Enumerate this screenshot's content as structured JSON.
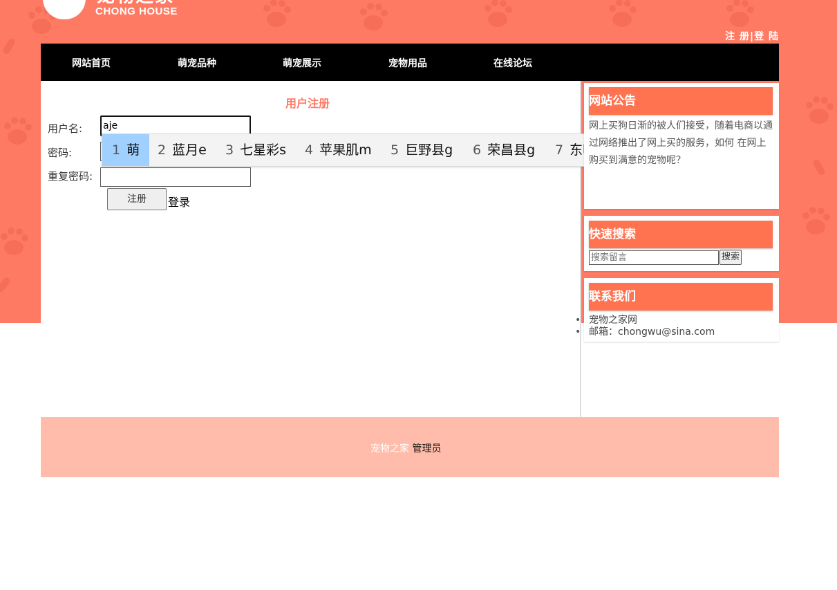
{
  "header": {
    "logo_title": "宠物之家",
    "logo_subtitle": "CHONG HOUSE",
    "register_link": "注 册",
    "separator": "|",
    "login_link": "登 陆"
  },
  "nav": {
    "items": [
      {
        "label": "网站首页"
      },
      {
        "label": "萌宠品种"
      },
      {
        "label": "萌宠展示"
      },
      {
        "label": "宠物用品"
      },
      {
        "label": "在线论坛"
      }
    ]
  },
  "register_form": {
    "title": "用户注册",
    "username_label": "用户名:",
    "username_value": "aje",
    "password_label": "密码:",
    "repeat_password_label": "重复密码:",
    "submit_label": "注册",
    "login_label": "登录"
  },
  "ime": {
    "candidates": [
      {
        "num": "1",
        "text": "萌"
      },
      {
        "num": "2",
        "text": "蓝月e"
      },
      {
        "num": "3",
        "text": "七星彩s"
      },
      {
        "num": "4",
        "text": "苹果肌m"
      },
      {
        "num": "5",
        "text": "巨野县g"
      },
      {
        "num": "6",
        "text": "荣昌县g"
      },
      {
        "num": "7",
        "text": "东明县g"
      }
    ],
    "prev_icon": "‹",
    "next_icon": "›",
    "emoji_icon": "☺"
  },
  "sidebar": {
    "notice_title": "网站公告",
    "notice_text": "网上买狗日渐的被人们接受，随着电商以通过网络推出了网上买的服务，如何 在网上购买到满意的宠物呢？",
    "search_title": "快速搜索",
    "search_placeholder": "搜索留言",
    "search_button": "搜索",
    "contact_title": "联系我们",
    "contact_items": [
      "宠物之家网",
      "邮箱：chongwu@sina.com"
    ]
  },
  "footer": {
    "site_name": "宠物之家",
    "admin_link": "管理员"
  },
  "colors": {
    "brand": "#ff7a63",
    "sidebar_head": "#ff7350",
    "footer_bg": "#ffbcaa",
    "ime_selected": "#9fd0ff"
  }
}
